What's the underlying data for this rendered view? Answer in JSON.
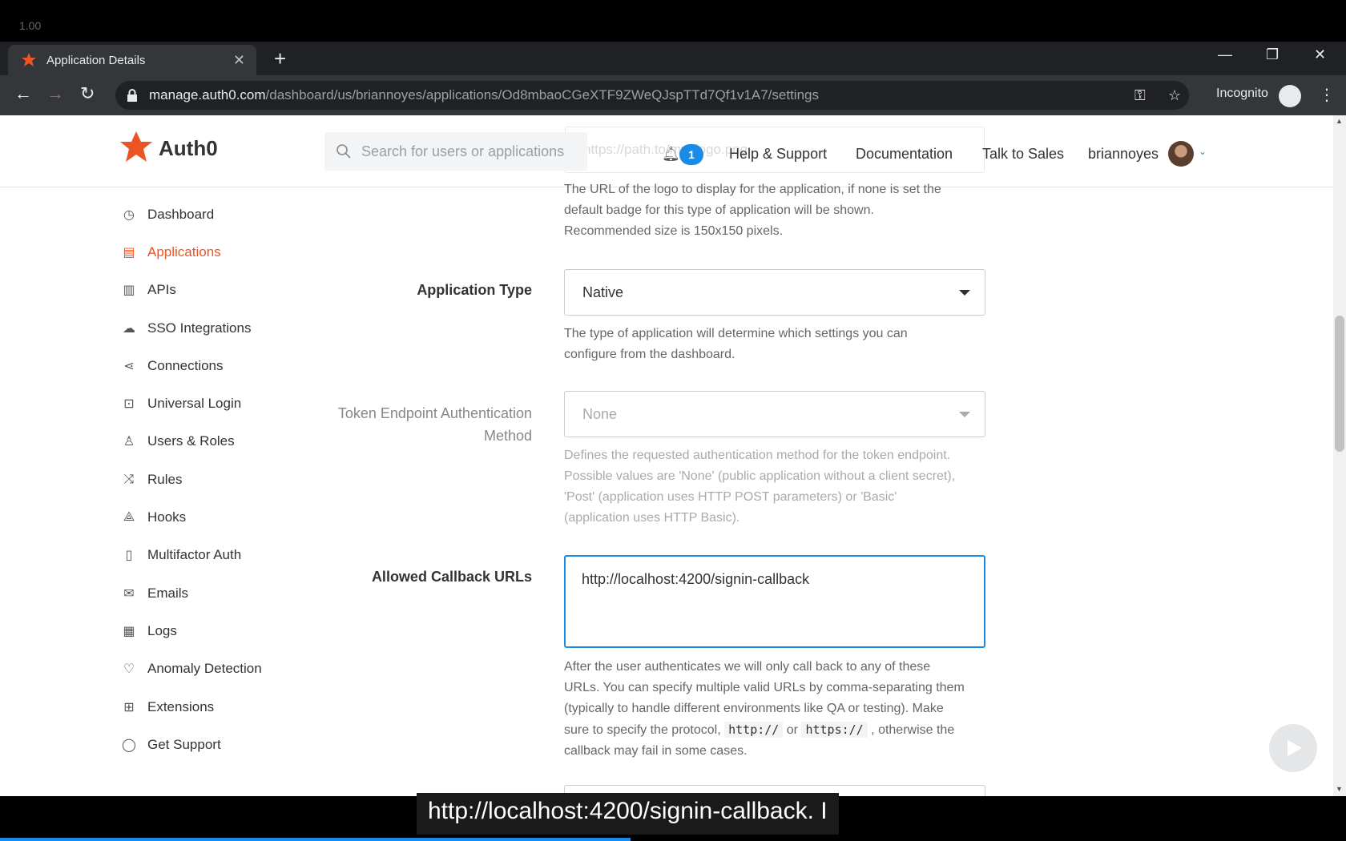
{
  "player": {
    "speed": "1.00"
  },
  "browser": {
    "tab_title": "Application Details",
    "url_host": "manage.auth0.com",
    "url_path": "/dashboard/us/briannoyes/applications/Od8mbaoCGeXTF9ZWeQJspTTd7Qf1v1A7/settings",
    "incognito_label": "Incognito"
  },
  "header": {
    "logo_text": "Auth0",
    "search_placeholder": "Search for users or applications",
    "ghost_input_text": "https://path.to/my_logo.png",
    "notification_count": "1",
    "help_link": "Help & Support",
    "docs_link": "Documentation",
    "sales_link": "Talk to Sales",
    "username": "briannoyes"
  },
  "sidebar": {
    "items": [
      {
        "label": "Dashboard",
        "icon": "dashboard-icon"
      },
      {
        "label": "Applications",
        "icon": "applications-icon",
        "active": true
      },
      {
        "label": "APIs",
        "icon": "apis-icon"
      },
      {
        "label": "SSO Integrations",
        "icon": "cloud-icon"
      },
      {
        "label": "Connections",
        "icon": "connections-icon"
      },
      {
        "label": "Universal Login",
        "icon": "universal-login-icon"
      },
      {
        "label": "Users & Roles",
        "icon": "users-icon"
      },
      {
        "label": "Rules",
        "icon": "rules-icon"
      },
      {
        "label": "Hooks",
        "icon": "hooks-icon"
      },
      {
        "label": "Multifactor Auth",
        "icon": "phone-icon"
      },
      {
        "label": "Emails",
        "icon": "email-icon"
      },
      {
        "label": "Logs",
        "icon": "logs-icon"
      },
      {
        "label": "Anomaly Detection",
        "icon": "heart-icon"
      },
      {
        "label": "Extensions",
        "icon": "extensions-icon"
      },
      {
        "label": "Get Support",
        "icon": "chat-icon"
      }
    ]
  },
  "form": {
    "logo_help_line1": "The URL of the logo to display for the application, if none is set the",
    "logo_help_line2": "default badge for this type of application will be shown.",
    "logo_help_line3": "Recommended size is 150x150 pixels.",
    "app_type_label": "Application Type",
    "app_type_value": "Native",
    "app_type_help_line1": "The type of application will determine which settings you can",
    "app_type_help_line2": "configure from the dashboard.",
    "token_label_line1": "Token Endpoint Authentication",
    "token_label_line2": "Method",
    "token_value": "None",
    "token_help_line1": "Defines the requested authentication method for the token endpoint.",
    "token_help_line2": "Possible values are 'None' (public application without a client secret),",
    "token_help_line3": "'Post' (application uses HTTP POST parameters) or 'Basic'",
    "token_help_line4": "(application uses HTTP Basic).",
    "callback_label": "Allowed Callback URLs",
    "callback_value": "http://localhost:4200/signin-callback",
    "callback_help_line1": "After the user authenticates we will only call back to any of these",
    "callback_help_line2": "URLs. You can specify multiple valid URLs by comma-separating them",
    "callback_help_line3": "(typically to handle different environments like QA or testing). Make",
    "callback_help_line4a": "sure to specify the protocol,",
    "callback_help_code1": "http://",
    "callback_help_or": "or",
    "callback_help_code2": "https://",
    "callback_help_line4b": ", otherwise the",
    "callback_help_line5": "callback may fail in some cases."
  },
  "caption": {
    "text": "http://localhost:4200/signin-callback. I"
  },
  "colors": {
    "accent": "#eb5424",
    "focus": "#1a8be6"
  }
}
